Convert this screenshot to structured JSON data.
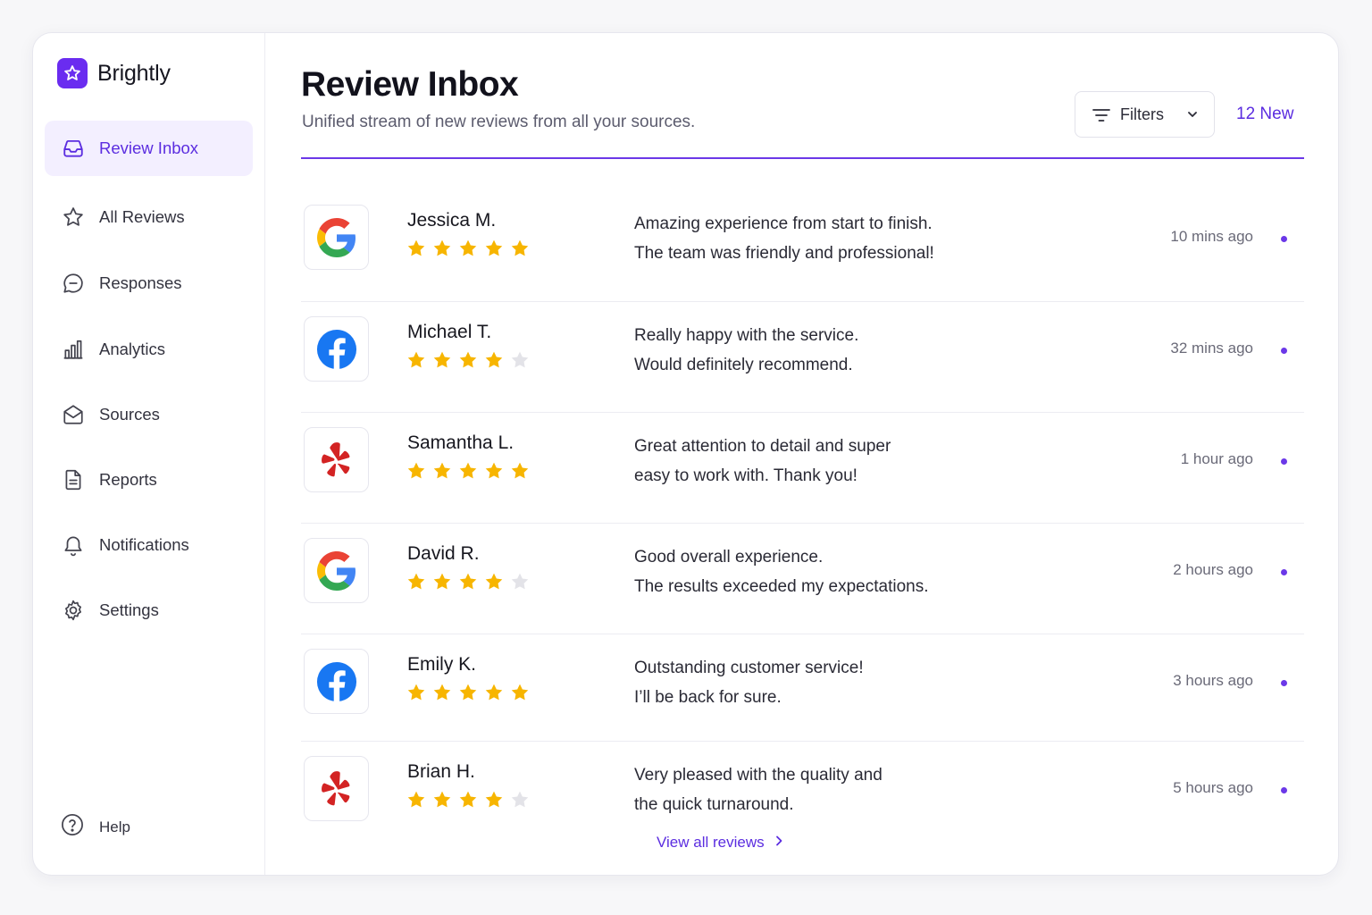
{
  "app": {
    "name": "Brightly",
    "brand_color": "#6a2cf0"
  },
  "sidebar": {
    "items": [
      {
        "label": "Review Inbox",
        "icon": "inbox-icon",
        "active": true
      },
      {
        "label": "All Reviews",
        "icon": "star-outline-icon",
        "active": false
      },
      {
        "label": "Responses",
        "icon": "chat-bubble-icon",
        "active": false
      },
      {
        "label": "Analytics",
        "icon": "bar-chart-icon",
        "active": false
      },
      {
        "label": "Sources",
        "icon": "envelope-icon",
        "active": false
      },
      {
        "label": "Reports",
        "icon": "document-icon",
        "active": false
      },
      {
        "label": "Notifications",
        "icon": "bell-icon",
        "active": false
      },
      {
        "label": "Settings",
        "icon": "gear-icon",
        "active": false
      }
    ],
    "help_label": "Help"
  },
  "header": {
    "title": "Review Inbox",
    "subtitle": "Unified stream of new reviews from all your sources.",
    "filters_label": "Filters",
    "new_count": "12 New"
  },
  "reviews": [
    {
      "source": "google",
      "name": "Jessica M.",
      "rating": 5,
      "lines": [
        "Amazing experience from start to finish.",
        "The team was friendly and professional!"
      ],
      "time": "10 mins ago",
      "unread": true
    },
    {
      "source": "facebook",
      "name": "Michael T.",
      "rating": 4,
      "lines": [
        "Really happy with the service.",
        "Would definitely recommend."
      ],
      "time": "32 mins ago",
      "unread": true
    },
    {
      "source": "yelp",
      "name": "Samantha L.",
      "rating": 5,
      "lines": [
        "Great attention to detail and super",
        "easy to work with. Thank you!"
      ],
      "time": "1 hour ago",
      "unread": true
    },
    {
      "source": "google",
      "name": "David R.",
      "rating": 4,
      "lines": [
        "Good overall experience.",
        "The results exceeded my expectations."
      ],
      "time": "2 hours ago",
      "unread": true
    },
    {
      "source": "facebook",
      "name": "Emily K.",
      "rating": 5,
      "lines": [
        "Outstanding customer service!",
        "I’ll be back for sure."
      ],
      "time": "3 hours ago",
      "unread": true
    },
    {
      "source": "yelp",
      "name": "Brian H.",
      "rating": 4,
      "lines": [
        "Very pleased with the quality and",
        "the quick turnaround."
      ],
      "time": "5 hours ago",
      "unread": true
    }
  ],
  "footer": {
    "view_all_label": "View all reviews"
  },
  "colors": {
    "accent": "#6b38e8",
    "star_filled": "#f7b500",
    "star_empty": "#e3e3e8",
    "google_blue": "#4285F4",
    "google_red": "#EA4335",
    "google_yellow": "#FBBC05",
    "google_green": "#34A853",
    "facebook_blue": "#1877F2",
    "yelp_red": "#D32323"
  }
}
